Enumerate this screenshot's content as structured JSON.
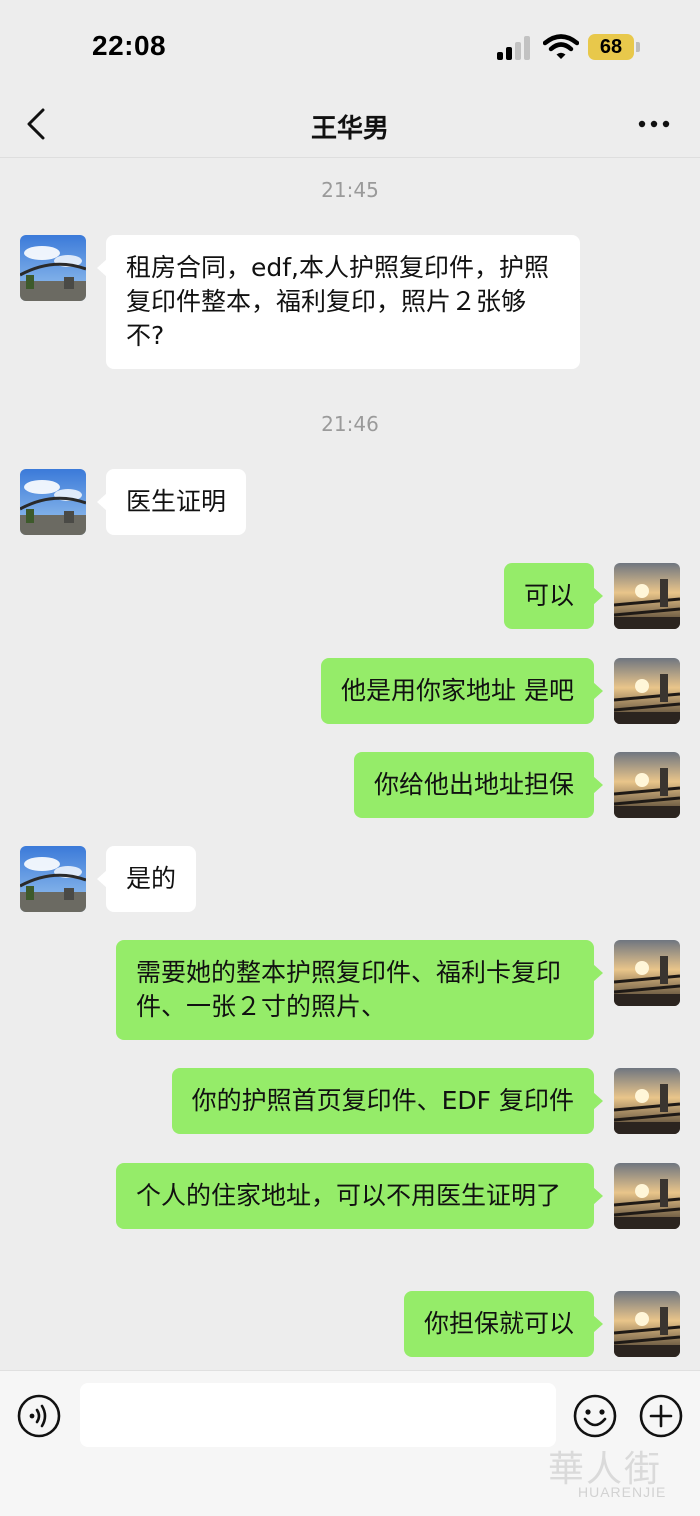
{
  "status_bar": {
    "time": "22:08",
    "battery": "68"
  },
  "header": {
    "title": "王华男"
  },
  "messages": [
    {
      "type": "timestamp",
      "text": "21:45"
    },
    {
      "type": "incoming",
      "text": "租房合同，edf,本人护照复印件，护照复印件整本，福利复印，照片２张够不?"
    },
    {
      "type": "timestamp",
      "text": "21:46"
    },
    {
      "type": "incoming",
      "text": "医生证明"
    },
    {
      "type": "outgoing",
      "text": "可以"
    },
    {
      "type": "outgoing",
      "text": "他是用你家地址 是吧"
    },
    {
      "type": "outgoing",
      "text": "你给他出地址担保"
    },
    {
      "type": "incoming",
      "text": "是的"
    },
    {
      "type": "outgoing",
      "text": "需要她的整本护照复印件、福利卡复印件、一张２寸的照片、"
    },
    {
      "type": "outgoing",
      "text": "你的护照首页复印件、EDF 复印件"
    },
    {
      "type": "outgoing",
      "text": "个人的住家地址，可以不用医生证明了"
    },
    {
      "type": "outgoing",
      "text": "你担保就可以"
    }
  ],
  "input_bar": {
    "placeholder": "",
    "icons": [
      "voice-icon",
      "emoji-icon",
      "plus-icon"
    ]
  },
  "watermark": {
    "cn": "華人街",
    "en": "HUARENJIE"
  },
  "colors": {
    "outgoing_bubble": "#95ec69",
    "incoming_bubble": "#ffffff",
    "background": "#ededed"
  }
}
